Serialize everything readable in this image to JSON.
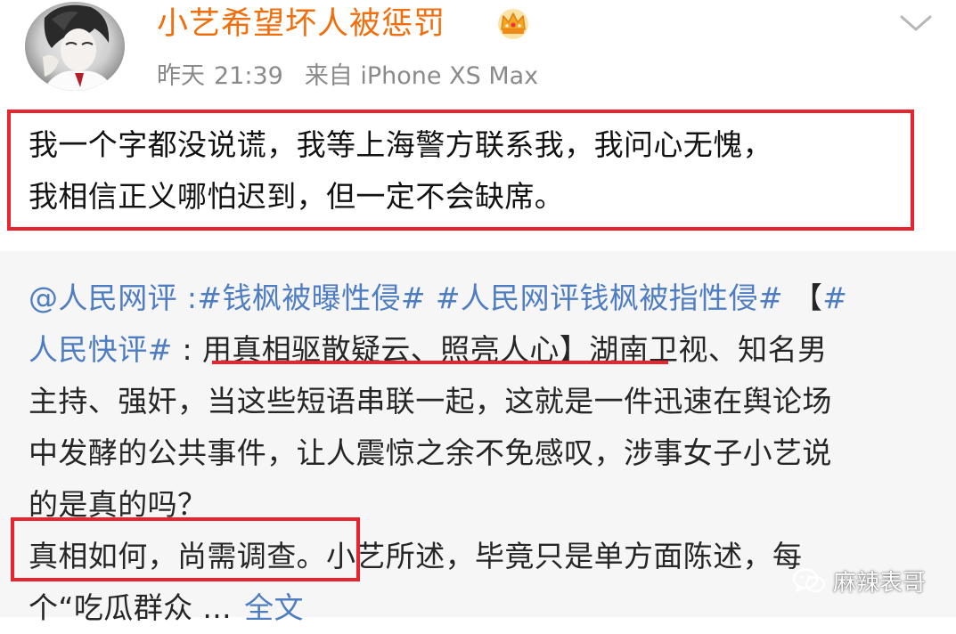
{
  "header": {
    "username": "小艺希望坏人被惩罚",
    "day": "昨天",
    "time": "21:39",
    "source": "来自 iPhone XS Max"
  },
  "post": {
    "lines": [
      "我一个字都没说谎，我等上海警方联系我，我问心无愧，",
      "我相信正义哪怕迟到，但一定不会缺席。"
    ]
  },
  "repost": {
    "line1": {
      "mention": "@人民网评",
      "separator": " :",
      "tag1": "#钱枫被曝性侵#",
      "tag2": "#人民网评钱枫被指性侵#",
      "bracket": "【",
      "tag3_start": "#"
    },
    "line2": {
      "tag3_end": "人民快评#",
      "colon": " : ",
      "headline": "用真相驱散疑云、照亮人心",
      "close_bracket": "】",
      "rest": "湖南卫视、知名男"
    },
    "line3": "主持、强奸，当这些短语串联一起，这就是一件迅速在舆论场",
    "line4": "中发酵的公共事件，让人震惊之余不免感叹，涉事女子小艺说",
    "line5": "的是真的吗？",
    "line6": {
      "boxed": "真相如何，尚需调查。",
      "rest": "小艺所述，毕竟只是单方面陈述，每"
    },
    "line7": {
      "text": "个“吃瓜群众 ...",
      "fulltext": "全文"
    }
  },
  "watermark": {
    "text": "麻辣表哥",
    "icon": "wechat-icon"
  },
  "colors": {
    "username": "#f16e0d",
    "meta": "#8a8a8a",
    "link": "#4f7dc2",
    "highlight": "#e8242e",
    "repost_bg": "#f6f6f6"
  }
}
